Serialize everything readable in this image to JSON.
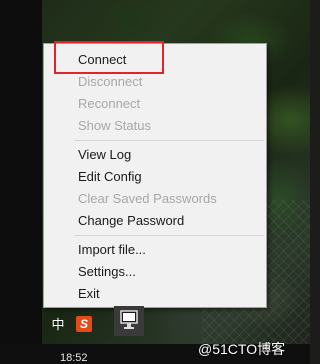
{
  "context_menu": {
    "items": [
      {
        "label": "Connect",
        "enabled": true
      },
      {
        "label": "Disconnect",
        "enabled": false
      },
      {
        "label": "Reconnect",
        "enabled": false
      },
      {
        "label": "Show Status",
        "enabled": false
      },
      {
        "label": "View Log",
        "enabled": true
      },
      {
        "label": "Edit Config",
        "enabled": true
      },
      {
        "label": "Clear Saved Passwords",
        "enabled": false
      },
      {
        "label": "Change Password",
        "enabled": true
      },
      {
        "label": "Import file...",
        "enabled": true
      },
      {
        "label": "Settings...",
        "enabled": true
      },
      {
        "label": "Exit",
        "enabled": true
      }
    ],
    "highlight_color": "#e0242b"
  },
  "taskbar": {
    "ime_label": "中",
    "sogou_label": "S",
    "clock": "18:52"
  },
  "watermark": "@51CTO博客",
  "colors": {
    "menu_bg": "#f1f1f1",
    "disabled_text": "#a7a7a7",
    "enabled_text": "#1a1a1a"
  },
  "icons": [
    "openvpn-tray-icon",
    "sogou-ime-icon"
  ]
}
